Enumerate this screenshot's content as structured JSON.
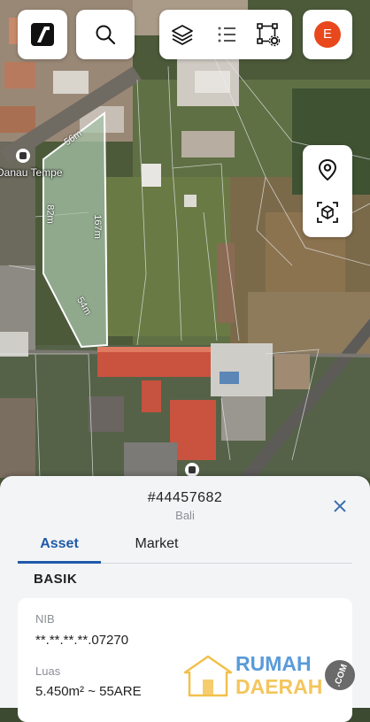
{
  "map": {
    "poi_label": "Danau Tempe",
    "dimensions": {
      "top": "56m",
      "left": "82m",
      "right": "167m",
      "bottom": "54m"
    },
    "colors": {
      "parcel_fill": "#a7c4a9",
      "parcel_stroke": "#ffffff",
      "roof_red": "#c7513e"
    }
  },
  "toolbar": {
    "logo_icon": "brand-logo-icon",
    "search_icon": "search-icon",
    "layers_icon": "layers-icon",
    "legend_icon": "list-icon",
    "draw_icon": "polygon-settings-icon",
    "avatar_initial": "E",
    "avatar_color": "#e8481c"
  },
  "side_controls": {
    "location_icon": "location-pin-icon",
    "view3d_icon": "3d-box-icon"
  },
  "sheet": {
    "parcel_id": "#44457682",
    "region": "Bali",
    "tabs": [
      "Asset",
      "Market"
    ],
    "active_tab": "Asset",
    "section_title": "BASIK",
    "fields": [
      {
        "label": "NIB",
        "value": "**.**.**.**.07270"
      },
      {
        "label": "Luas",
        "value": "5.450m² ~ 55ARE"
      }
    ]
  },
  "watermark": {
    "line1": "RUMAH",
    "line2": "DAERAH",
    "suffix": ".COM"
  }
}
